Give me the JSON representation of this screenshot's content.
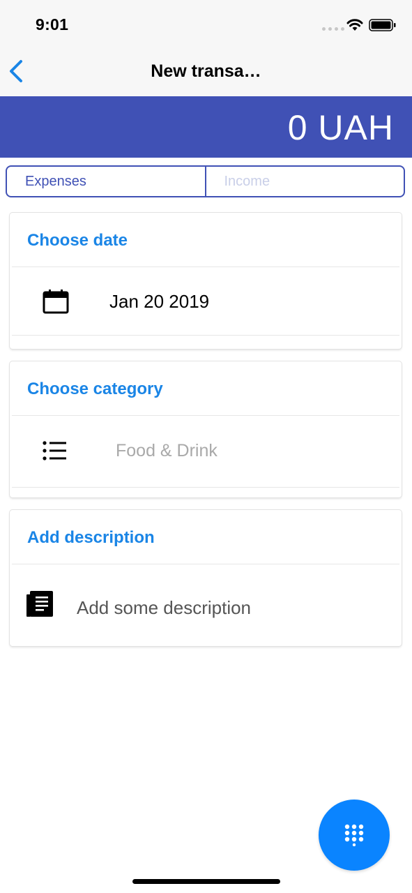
{
  "status_bar": {
    "time": "9:01"
  },
  "nav": {
    "title": "New transa…"
  },
  "amount": {
    "value": "0 UAH"
  },
  "segments": {
    "expenses": "Expenses",
    "income": "Income"
  },
  "date_card": {
    "title": "Choose date",
    "value": "Jan 20 2019",
    "icon": "calendar-icon"
  },
  "category_card": {
    "title": "Choose category",
    "value": "Food & Drink",
    "icon": "list-icon"
  },
  "description_card": {
    "title": "Add description",
    "placeholder": "Add some description",
    "icon": "document-icon"
  },
  "fab": {
    "icon": "keypad-icon"
  },
  "colors": {
    "header": "#4051b5",
    "accent": "#1a85e6",
    "fab": "#0a84ff"
  }
}
